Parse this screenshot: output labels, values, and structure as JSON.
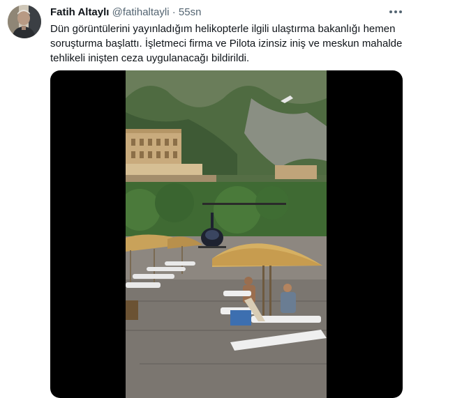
{
  "tweet": {
    "author_name": "Fatih Altaylı",
    "handle": "@fatihaltayli",
    "separator": "·",
    "timestamp": "55sn",
    "text": "Dün görüntülerini yayınladığım helikopterle ilgili ulaştırma bakanlığı hemen soruşturma başlattı. İşletmeci firma ve Pilota izinsiz iniş ve meskun mahalde tehlikeli inişten ceza uygulanacağı bildirildi."
  },
  "icons": {
    "more": "more-horizontal-icon",
    "avatar": "avatar-photo"
  },
  "media": {
    "subject": "helicopter-landing-on-beach-video"
  },
  "colors": {
    "text_primary": "#0f1419",
    "text_secondary": "#536471",
    "media_background": "#000000"
  }
}
